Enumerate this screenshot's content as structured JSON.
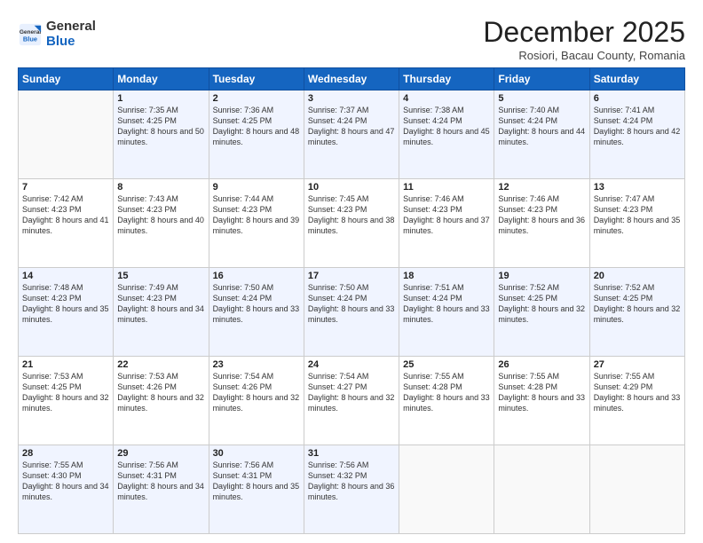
{
  "header": {
    "logo_general": "General",
    "logo_blue": "Blue",
    "month_title": "December 2025",
    "location": "Rosiori, Bacau County, Romania"
  },
  "weekdays": [
    "Sunday",
    "Monday",
    "Tuesday",
    "Wednesday",
    "Thursday",
    "Friday",
    "Saturday"
  ],
  "weeks": [
    [
      {
        "day": "",
        "sunrise": "",
        "sunset": "",
        "daylight": ""
      },
      {
        "day": "1",
        "sunrise": "Sunrise: 7:35 AM",
        "sunset": "Sunset: 4:25 PM",
        "daylight": "Daylight: 8 hours and 50 minutes."
      },
      {
        "day": "2",
        "sunrise": "Sunrise: 7:36 AM",
        "sunset": "Sunset: 4:25 PM",
        "daylight": "Daylight: 8 hours and 48 minutes."
      },
      {
        "day": "3",
        "sunrise": "Sunrise: 7:37 AM",
        "sunset": "Sunset: 4:24 PM",
        "daylight": "Daylight: 8 hours and 47 minutes."
      },
      {
        "day": "4",
        "sunrise": "Sunrise: 7:38 AM",
        "sunset": "Sunset: 4:24 PM",
        "daylight": "Daylight: 8 hours and 45 minutes."
      },
      {
        "day": "5",
        "sunrise": "Sunrise: 7:40 AM",
        "sunset": "Sunset: 4:24 PM",
        "daylight": "Daylight: 8 hours and 44 minutes."
      },
      {
        "day": "6",
        "sunrise": "Sunrise: 7:41 AM",
        "sunset": "Sunset: 4:24 PM",
        "daylight": "Daylight: 8 hours and 42 minutes."
      }
    ],
    [
      {
        "day": "7",
        "sunrise": "Sunrise: 7:42 AM",
        "sunset": "Sunset: 4:23 PM",
        "daylight": "Daylight: 8 hours and 41 minutes."
      },
      {
        "day": "8",
        "sunrise": "Sunrise: 7:43 AM",
        "sunset": "Sunset: 4:23 PM",
        "daylight": "Daylight: 8 hours and 40 minutes."
      },
      {
        "day": "9",
        "sunrise": "Sunrise: 7:44 AM",
        "sunset": "Sunset: 4:23 PM",
        "daylight": "Daylight: 8 hours and 39 minutes."
      },
      {
        "day": "10",
        "sunrise": "Sunrise: 7:45 AM",
        "sunset": "Sunset: 4:23 PM",
        "daylight": "Daylight: 8 hours and 38 minutes."
      },
      {
        "day": "11",
        "sunrise": "Sunrise: 7:46 AM",
        "sunset": "Sunset: 4:23 PM",
        "daylight": "Daylight: 8 hours and 37 minutes."
      },
      {
        "day": "12",
        "sunrise": "Sunrise: 7:46 AM",
        "sunset": "Sunset: 4:23 PM",
        "daylight": "Daylight: 8 hours and 36 minutes."
      },
      {
        "day": "13",
        "sunrise": "Sunrise: 7:47 AM",
        "sunset": "Sunset: 4:23 PM",
        "daylight": "Daylight: 8 hours and 35 minutes."
      }
    ],
    [
      {
        "day": "14",
        "sunrise": "Sunrise: 7:48 AM",
        "sunset": "Sunset: 4:23 PM",
        "daylight": "Daylight: 8 hours and 35 minutes."
      },
      {
        "day": "15",
        "sunrise": "Sunrise: 7:49 AM",
        "sunset": "Sunset: 4:23 PM",
        "daylight": "Daylight: 8 hours and 34 minutes."
      },
      {
        "day": "16",
        "sunrise": "Sunrise: 7:50 AM",
        "sunset": "Sunset: 4:24 PM",
        "daylight": "Daylight: 8 hours and 33 minutes."
      },
      {
        "day": "17",
        "sunrise": "Sunrise: 7:50 AM",
        "sunset": "Sunset: 4:24 PM",
        "daylight": "Daylight: 8 hours and 33 minutes."
      },
      {
        "day": "18",
        "sunrise": "Sunrise: 7:51 AM",
        "sunset": "Sunset: 4:24 PM",
        "daylight": "Daylight: 8 hours and 33 minutes."
      },
      {
        "day": "19",
        "sunrise": "Sunrise: 7:52 AM",
        "sunset": "Sunset: 4:25 PM",
        "daylight": "Daylight: 8 hours and 32 minutes."
      },
      {
        "day": "20",
        "sunrise": "Sunrise: 7:52 AM",
        "sunset": "Sunset: 4:25 PM",
        "daylight": "Daylight: 8 hours and 32 minutes."
      }
    ],
    [
      {
        "day": "21",
        "sunrise": "Sunrise: 7:53 AM",
        "sunset": "Sunset: 4:25 PM",
        "daylight": "Daylight: 8 hours and 32 minutes."
      },
      {
        "day": "22",
        "sunrise": "Sunrise: 7:53 AM",
        "sunset": "Sunset: 4:26 PM",
        "daylight": "Daylight: 8 hours and 32 minutes."
      },
      {
        "day": "23",
        "sunrise": "Sunrise: 7:54 AM",
        "sunset": "Sunset: 4:26 PM",
        "daylight": "Daylight: 8 hours and 32 minutes."
      },
      {
        "day": "24",
        "sunrise": "Sunrise: 7:54 AM",
        "sunset": "Sunset: 4:27 PM",
        "daylight": "Daylight: 8 hours and 32 minutes."
      },
      {
        "day": "25",
        "sunrise": "Sunrise: 7:55 AM",
        "sunset": "Sunset: 4:28 PM",
        "daylight": "Daylight: 8 hours and 33 minutes."
      },
      {
        "day": "26",
        "sunrise": "Sunrise: 7:55 AM",
        "sunset": "Sunset: 4:28 PM",
        "daylight": "Daylight: 8 hours and 33 minutes."
      },
      {
        "day": "27",
        "sunrise": "Sunrise: 7:55 AM",
        "sunset": "Sunset: 4:29 PM",
        "daylight": "Daylight: 8 hours and 33 minutes."
      }
    ],
    [
      {
        "day": "28",
        "sunrise": "Sunrise: 7:55 AM",
        "sunset": "Sunset: 4:30 PM",
        "daylight": "Daylight: 8 hours and 34 minutes."
      },
      {
        "day": "29",
        "sunrise": "Sunrise: 7:56 AM",
        "sunset": "Sunset: 4:31 PM",
        "daylight": "Daylight: 8 hours and 34 minutes."
      },
      {
        "day": "30",
        "sunrise": "Sunrise: 7:56 AM",
        "sunset": "Sunset: 4:31 PM",
        "daylight": "Daylight: 8 hours and 35 minutes."
      },
      {
        "day": "31",
        "sunrise": "Sunrise: 7:56 AM",
        "sunset": "Sunset: 4:32 PM",
        "daylight": "Daylight: 8 hours and 36 minutes."
      },
      {
        "day": "",
        "sunrise": "",
        "sunset": "",
        "daylight": ""
      },
      {
        "day": "",
        "sunrise": "",
        "sunset": "",
        "daylight": ""
      },
      {
        "day": "",
        "sunrise": "",
        "sunset": "",
        "daylight": ""
      }
    ]
  ]
}
